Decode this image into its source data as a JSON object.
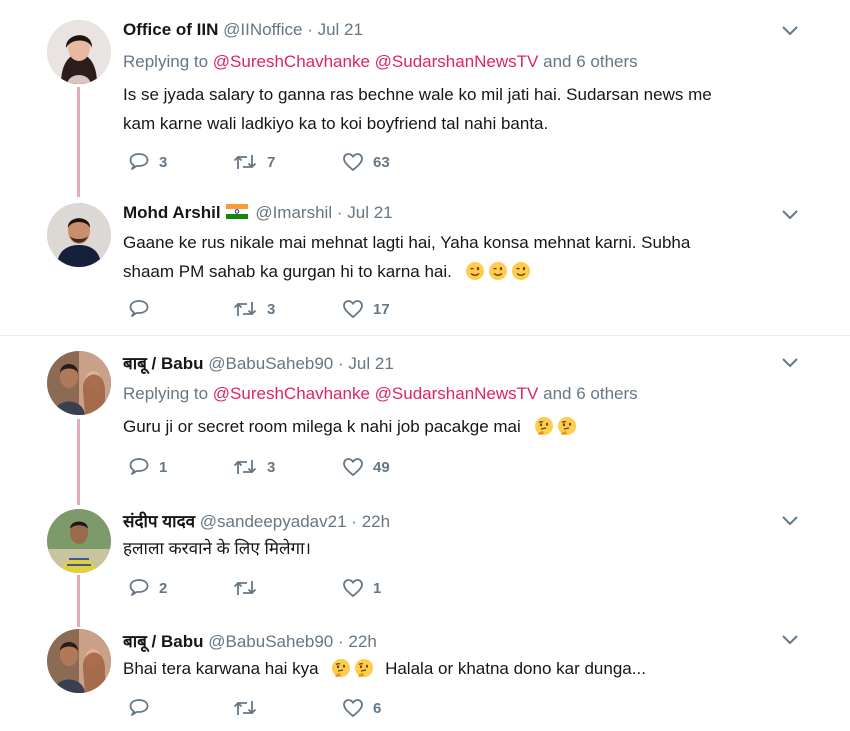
{
  "colors": {
    "accent": "#e0245e",
    "thread_line": "#e8a9b6",
    "muted": "#657786"
  },
  "tweets": [
    {
      "name": "Office of IIN",
      "handle": "@IINoffice",
      "separator": "·",
      "time": "Jul 21",
      "reply_prefix": "Replying to",
      "mention1": "@SureshChavhanke",
      "mention2": "@SudarshanNewsTV",
      "reply_suffix": "and 6 others",
      "text_line1": "Is se jyada salary to ganna ras bechne wale ko mil jati hai. Sudarsan news me",
      "text_line2": "kam karne wali ladkiyo ka to koi boyfriend tal nahi banta.",
      "replies": "3",
      "retweets": "7",
      "likes": "63"
    },
    {
      "name": "Mohd Arshil",
      "flag": "india-flag-icon",
      "handle": "@Imarshil",
      "separator": "·",
      "time": "Jul 21",
      "text_line1": "Gaane ke rus nikale mai mehnat lagti hai, Yaha konsa mehnat karni. Subha",
      "text_line2": "shaam PM sahab ka gurgan hi to karna hai.",
      "emoji": "winking-face-icon",
      "replies": "",
      "retweets": "3",
      "likes": "17"
    },
    {
      "name": "बाबू / Babu",
      "handle": "@BabuSaheb90",
      "separator": "·",
      "time": "Jul 21",
      "reply_prefix": "Replying to",
      "mention1": "@SureshChavhanke",
      "mention2": "@SudarshanNewsTV",
      "reply_suffix": "and 6 others",
      "text_line1": "Guru ji or secret room milega k nahi job pacakge mai",
      "emoji": "thinking-face-icon",
      "replies": "1",
      "retweets": "3",
      "likes": "49"
    },
    {
      "name": "संदीप यादव",
      "handle": "@sandeepyadav21",
      "separator": "·",
      "time": "22h",
      "text_line1": "हलाला करवाने के लिए मिलेगा।",
      "replies": "2",
      "retweets": "",
      "likes": "1"
    },
    {
      "name": "बाबू / Babu",
      "handle": "@BabuSaheb90",
      "separator": "·",
      "time": "22h",
      "text_before": "Bhai tera karwana hai kya",
      "text_after": "Halala or khatna dono kar dunga...",
      "emoji": "thinking-face-icon",
      "replies": "",
      "retweets": "",
      "likes": "6"
    }
  ]
}
